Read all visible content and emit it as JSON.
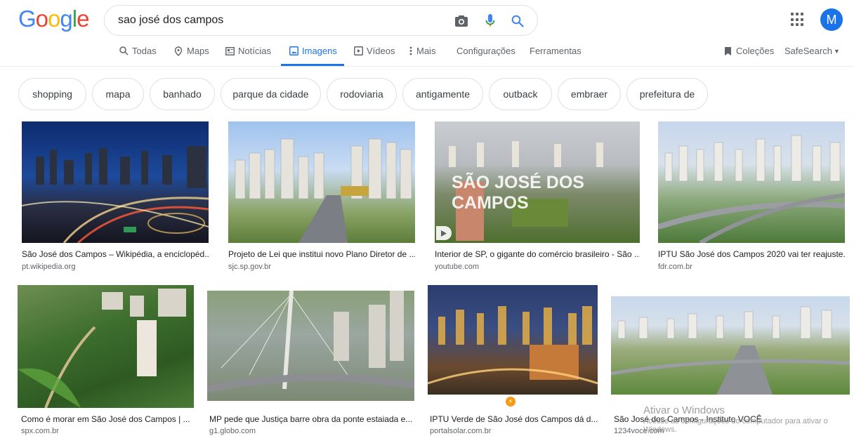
{
  "logo": [
    "G",
    "o",
    "o",
    "g",
    "l",
    "e"
  ],
  "logo_colors": [
    "#4285F4",
    "#EA4335",
    "#FBBC05",
    "#4285F4",
    "#34A853",
    "#EA4335"
  ],
  "search": {
    "value": "sao josé dos campos"
  },
  "avatar": "M",
  "tabs": [
    {
      "label": "Todas",
      "icon": "search-icon"
    },
    {
      "label": "Maps",
      "icon": "map-pin-icon"
    },
    {
      "label": "Notícias",
      "icon": "news-icon"
    },
    {
      "label": "Imagens",
      "icon": "image-icon",
      "active": true
    },
    {
      "label": "Vídeos",
      "icon": "play-icon"
    },
    {
      "label": "Mais",
      "icon": "more-icon"
    },
    {
      "label": "Configurações"
    },
    {
      "label": "Ferramentas"
    }
  ],
  "right_tabs": {
    "collections": "Coleções",
    "safesearch": "SafeSearch"
  },
  "chips": [
    "shopping",
    "mapa",
    "banhado",
    "parque da cidade",
    "rodoviaria",
    "antigamente",
    "outback",
    "embraer",
    "prefeitura de"
  ],
  "results": [
    {
      "title": "São José dos Campos – Wikipédia, a enciclopéd...",
      "source": "pt.wikipedia.org"
    },
    {
      "title": "Projeto de Lei que institui novo Plano Diretor de ...",
      "source": "sjc.sp.gov.br"
    },
    {
      "title": "Interior de SP, o gigante do comércio brasileiro - São ...",
      "source": "youtube.com",
      "overlay": "SÃO JOSÉ DOS CAMPOS"
    },
    {
      "title": "IPTU São José dos Campos 2020 vai ter reajuste...",
      "source": "fdr.com.br"
    },
    {
      "title": "Como é morar em São José dos Campos | ...",
      "source": "spx.com.br"
    },
    {
      "title": "MP pede que Justiça barre obra da ponte estaiada e...",
      "source": "g1.globo.com"
    },
    {
      "title": "IPTU Verde de São José dos Campos dá d...",
      "source": "portalsolar.com.br"
    },
    {
      "title": "São José dos Campos - Instituto VOCÊ",
      "source": "1234voce.com"
    }
  ],
  "watermark": {
    "line1": "Ativar o Windows",
    "line2": "Acesse as configurações do computador para ativar o Windows."
  },
  "colors": {
    "accent": "#1a73e8",
    "avatar": "#1a73e8"
  }
}
